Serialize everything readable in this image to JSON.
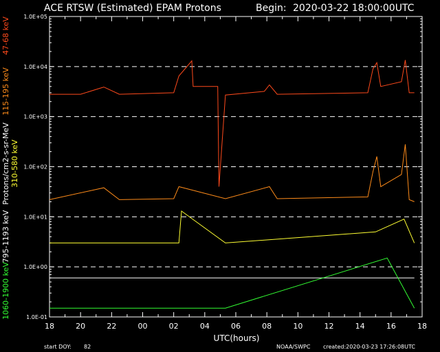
{
  "header": {
    "title": "ACE RTSW (Estimated) EPAM Protons",
    "begin_label": "Begin:",
    "begin_value": "2020-03-22 18:00:00UTC"
  },
  "footer": {
    "start_doy_label": "start DOY:",
    "start_doy_value": "82",
    "credit": "NOAA/SWPC",
    "created": "created:2020-03-23 17:26:08UTC"
  },
  "colors": {
    "background": "#000000",
    "frame": "#ffffff",
    "ch1": "#ff4a1c",
    "ch2": "#ff8c1a",
    "ch3": "#ffff33",
    "ch4": "#ffffff",
    "ch5": "#33ff33"
  },
  "chart_data": {
    "type": "line",
    "title": "ACE RTSW (Estimated) EPAM Protons",
    "xlabel": "UTC(hours)",
    "ylabel": "Protons/cm2-s-sr-MeV",
    "y_scale": "log",
    "ylim": [
      0.1,
      100000
    ],
    "xlim": [
      "2020-03-22 18:00",
      "2020-03-23 18:00"
    ],
    "x_ticks": [
      "18",
      "20",
      "22",
      "00",
      "02",
      "04",
      "06",
      "08",
      "10",
      "12",
      "14",
      "16",
      "18"
    ],
    "y_ticks": [
      "1.0E-01",
      "1.0E+00",
      "1.0E+01",
      "1.0E+02",
      "1.0E+03",
      "1.0E+04",
      "1.0E+05"
    ],
    "gridlines_y": [
      1,
      10,
      100,
      1000,
      10000
    ],
    "series": [
      {
        "name": "47-68 keV",
        "color": "#ff4a1c",
        "points": [
          [
            "2020-03-22 18:00",
            2800
          ],
          [
            "2020-03-22 20:00",
            2800
          ],
          [
            "2020-03-22 21:30",
            3900
          ],
          [
            "2020-03-22 22:30",
            2800
          ],
          [
            "2020-03-23 02:00",
            3000
          ],
          [
            "2020-03-23 02:20",
            6500
          ],
          [
            "2020-03-23 03:10",
            13000
          ],
          [
            "2020-03-23 03:15",
            4000
          ],
          [
            "2020-03-23 04:50",
            4000
          ],
          [
            "2020-03-23 04:55",
            40
          ],
          [
            "2020-03-23 05:20",
            2700
          ],
          [
            "2020-03-23 07:50",
            3200
          ],
          [
            "2020-03-23 08:10",
            4300
          ],
          [
            "2020-03-23 08:40",
            2800
          ],
          [
            "2020-03-23 14:30",
            3000
          ],
          [
            "2020-03-23 14:50",
            9000
          ],
          [
            "2020-03-23 15:05",
            12000
          ],
          [
            "2020-03-23 15:20",
            4000
          ],
          [
            "2020-03-23 16:40",
            5000
          ],
          [
            "2020-03-23 16:55",
            13500
          ],
          [
            "2020-03-23 17:10",
            3000
          ],
          [
            "2020-03-23 17:30",
            3000
          ]
        ]
      },
      {
        "name": "115-195 keV",
        "color": "#ff8c1a",
        "points": [
          [
            "2020-03-22 18:00",
            22
          ],
          [
            "2020-03-22 21:30",
            38
          ],
          [
            "2020-03-22 22:30",
            22
          ],
          [
            "2020-03-23 02:00",
            23
          ],
          [
            "2020-03-23 02:20",
            40
          ],
          [
            "2020-03-23 05:20",
            23
          ],
          [
            "2020-03-23 08:10",
            40
          ],
          [
            "2020-03-23 08:40",
            23
          ],
          [
            "2020-03-23 14:30",
            25
          ],
          [
            "2020-03-23 14:50",
            80
          ],
          [
            "2020-03-23 15:05",
            160
          ],
          [
            "2020-03-23 15:20",
            40
          ],
          [
            "2020-03-23 16:40",
            70
          ],
          [
            "2020-03-23 16:55",
            280
          ],
          [
            "2020-03-23 17:10",
            22
          ],
          [
            "2020-03-23 17:30",
            20
          ]
        ]
      },
      {
        "name": "310-580 keV",
        "color": "#ffff33",
        "points": [
          [
            "2020-03-22 18:00",
            3
          ],
          [
            "2020-03-23 02:20",
            3
          ],
          [
            "2020-03-23 02:30",
            13
          ],
          [
            "2020-03-23 05:20",
            3
          ],
          [
            "2020-03-23 15:00",
            5
          ],
          [
            "2020-03-23 16:50",
            9
          ],
          [
            "2020-03-23 17:30",
            3
          ]
        ]
      },
      {
        "name": "795-1193 keV",
        "color": "#ffffff",
        "points": [
          [
            "2020-03-22 18:00",
            0.6
          ],
          [
            "2020-03-23 02:20",
            0.6
          ],
          [
            "2020-03-23 05:20",
            0.6
          ],
          [
            "2020-03-23 17:30",
            0.6
          ]
        ]
      },
      {
        "name": "1060-1900 keV",
        "color": "#33ff33",
        "points": [
          [
            "2020-03-22 18:00",
            0.15
          ],
          [
            "2020-03-23 02:20",
            0.15
          ],
          [
            "2020-03-23 05:20",
            0.15
          ],
          [
            "2020-03-23 15:45",
            1.5
          ],
          [
            "2020-03-23 17:30",
            0.15
          ]
        ]
      }
    ]
  }
}
